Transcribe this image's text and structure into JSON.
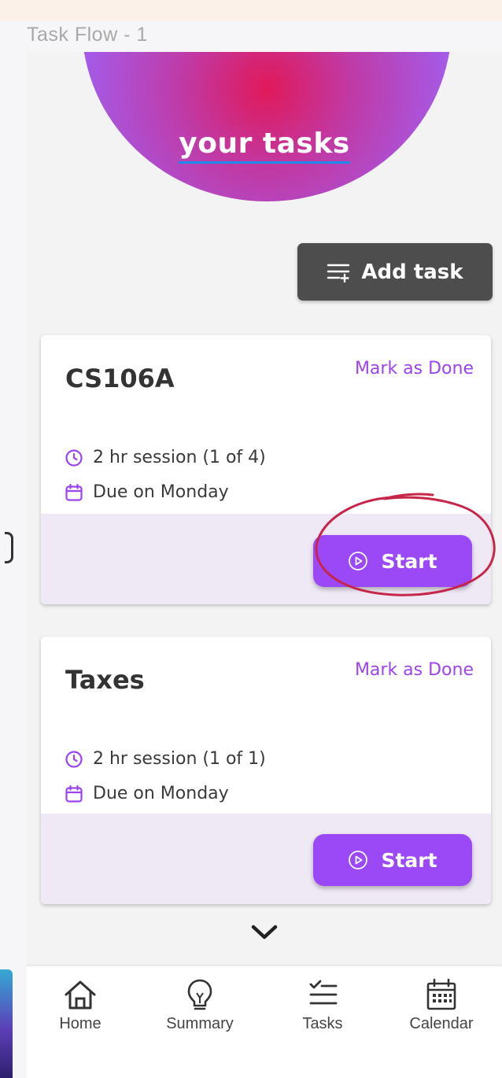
{
  "frame": {
    "title": "Task Flow - 1"
  },
  "hero": {
    "title": "your tasks"
  },
  "toolbar": {
    "add_label": "Add task",
    "add_icon": "add-list-icon"
  },
  "tasks": [
    {
      "title": "CS106A",
      "mark_label": "Mark as Done",
      "session": "2 hr session (1 of 4)",
      "due": "Due on Monday",
      "start_label": "Start"
    },
    {
      "title": "Taxes",
      "mark_label": "Mark as Done",
      "session": "2 hr session (1 of 1)",
      "due": "Due on Monday",
      "start_label": "Start"
    }
  ],
  "nav": [
    {
      "label": "Home",
      "icon": "home-icon"
    },
    {
      "label": "Summary",
      "icon": "lightbulb-icon"
    },
    {
      "label": "Tasks",
      "icon": "checklist-icon"
    },
    {
      "label": "Calendar",
      "icon": "calendar-icon"
    }
  ],
  "colors": {
    "accent": "#9b48f7",
    "hero_center": "#e0195a",
    "hero_edge": "#a46cf3",
    "annotation": "#c6264a",
    "dark_button": "#4d4d4d"
  }
}
